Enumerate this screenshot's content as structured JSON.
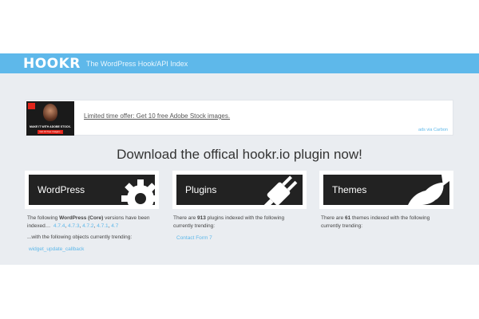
{
  "header": {
    "logo": "HOOKR",
    "tagline": "The WordPress Hook/API Index"
  },
  "ad": {
    "image_line1": "MAKE IT WITH ADOBE STOCK.",
    "image_line2": "Get 10 free images ›",
    "text": "Limited time offer: Get 10 free Adobe Stock images.",
    "via": "ads via Carbon"
  },
  "headline": "Download the offical hookr.io plugin now!",
  "cards": [
    {
      "label": "WordPress",
      "icon": "gear-icon",
      "desc_prefix": "The following ",
      "desc_bold": "WordPress (Core)",
      "desc_suffix": " versions have been indexed…",
      "versions": [
        "4.7.4",
        "4.7.3",
        "4.7.2",
        "4.7.1",
        "4.7"
      ],
      "trending_intro": "...with the following objects currently trending:",
      "trending": [
        "widget_update_callback"
      ]
    },
    {
      "label": "Plugins",
      "icon": "plug-icon",
      "desc_prefix": "There are ",
      "desc_bold": "913",
      "desc_suffix": " plugins indexed with the following currently trending:",
      "trending": [
        "Contact Form 7"
      ]
    },
    {
      "label": "Themes",
      "icon": "brush-icon",
      "desc_prefix": "There are ",
      "desc_bold": "61",
      "desc_suffix": " themes indexed with the following currently trending:",
      "trending": []
    }
  ],
  "colors": {
    "brand": "#5eb8ea",
    "page_bg": "#eaedf1",
    "card_dark": "#222222",
    "adobe_red": "#e1251b"
  }
}
